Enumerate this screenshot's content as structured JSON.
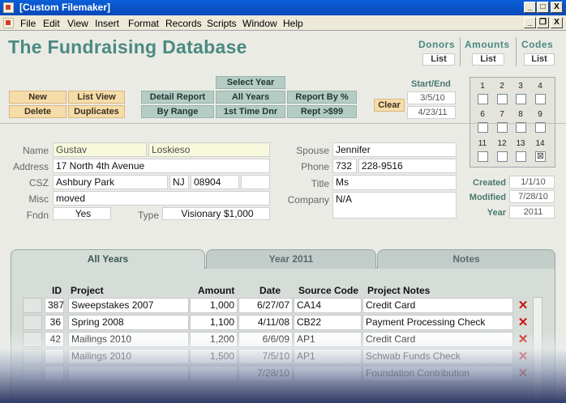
{
  "window": {
    "title": "[Custom Filemaker]",
    "minimize_glyph": "_",
    "maximize_glyph": "□",
    "close_glyph": "X",
    "restore_glyph": "❐"
  },
  "menu": [
    "File",
    "Edit",
    "View",
    "Insert",
    "Format",
    "Records",
    "Scripts",
    "Window",
    "Help"
  ],
  "header": {
    "title": "The Fundraising Database",
    "nav": [
      {
        "heading": "Donors",
        "button": "List"
      },
      {
        "heading": "Amounts",
        "button": "List"
      },
      {
        "heading": "Codes",
        "button": "List"
      }
    ]
  },
  "toolbar": {
    "new": "New",
    "list_view": "List View",
    "delete": "Delete",
    "duplicates": "Duplicates",
    "select_year": "Select Year",
    "detail_report": "Detail Report",
    "all_years": "All Years",
    "report_by_pct": "Report By %",
    "by_range": "By Range",
    "first_time_donor": "1st Time Dnr",
    "rept_99": "Rept >$99",
    "start_end_label": "Start/End",
    "start_date": "3/5/10",
    "end_date": "4/23/11",
    "clear": "Clear"
  },
  "grid": {
    "numbers": [
      "1",
      "2",
      "3",
      "4",
      "6",
      "7",
      "8",
      "9",
      "11",
      "12",
      "13",
      "14"
    ],
    "checked": [
      false,
      false,
      false,
      false,
      false,
      false,
      false,
      false,
      false,
      false,
      false,
      true
    ],
    "check_mark": "⊠"
  },
  "donor": {
    "labels": {
      "name": "Name",
      "address": "Address",
      "csz": "CSZ",
      "misc": "Misc",
      "fndn": "Fndn",
      "type": "Type",
      "spouse": "Spouse",
      "phone": "Phone",
      "title": "Title",
      "company": "Company"
    },
    "first_name": "Gustav",
    "last_name": "Loskieso",
    "address": "17 North 4th Avenue",
    "city": "Ashbury Park",
    "state": "NJ",
    "zip": "08904",
    "misc": "moved",
    "fndn": "Yes",
    "type": "Visionary $1,000",
    "spouse": "Jennifer",
    "phone_area": "732",
    "phone_number": "228-9516",
    "title": "Ms",
    "company": "N/A"
  },
  "meta": {
    "created_label": "Created",
    "created": "1/1/10",
    "modified_label": "Modified",
    "modified": "7/28/10",
    "year_label": "Year",
    "year": "2011"
  },
  "tabs": [
    "All Years",
    "Year 2011",
    "Notes"
  ],
  "table": {
    "headers": [
      "ID",
      "Project",
      "Amount",
      "Date",
      "Source Code",
      "Project Notes"
    ],
    "delete_glyph": "✕",
    "rows": [
      {
        "id": "387",
        "project": "Sweepstakes 2007",
        "amount": "1,000",
        "date": "6/27/07",
        "code": "CA14",
        "notes": "Credit Card"
      },
      {
        "id": "36",
        "project": "Spring 2008",
        "amount": "1,100",
        "date": "4/11/08",
        "code": "CB22",
        "notes": "Payment Processing Check"
      },
      {
        "id": "42",
        "project": "Mailings 2010",
        "amount": "1,200",
        "date": "6/6/09",
        "code": "AP1",
        "notes": "Credit Card"
      },
      {
        "id": "",
        "project": "Mailings 2010",
        "amount": "1,500",
        "date": "7/5/10",
        "code": "AP1",
        "notes": "Schwab Funds Check"
      },
      {
        "id": "",
        "project": "",
        "amount": "",
        "date": "7/28/10",
        "code": "",
        "notes": "Foundation Contribution"
      }
    ]
  }
}
